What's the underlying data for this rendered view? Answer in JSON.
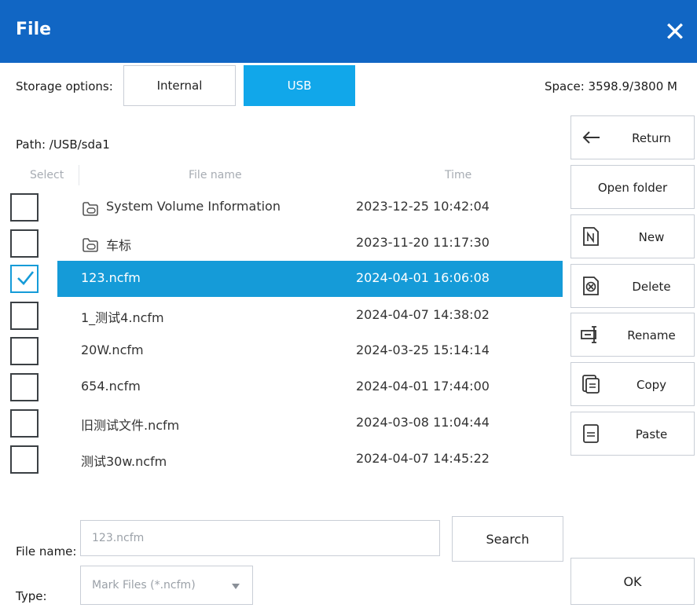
{
  "window": {
    "title": "File",
    "close_glyph": "✕"
  },
  "storage": {
    "label": "Storage options:",
    "options": [
      "Internal",
      "USB"
    ],
    "selected": "USB",
    "space": "Space:  3598.9/3800  M"
  },
  "path": "Path:  /USB/sda1",
  "table": {
    "headers": {
      "select": "Select",
      "name": "File name",
      "time": "Time"
    },
    "rows": [
      {
        "name": "System Volume Information",
        "time": "2023-12-25  10:42:04",
        "folder": true,
        "checked": false,
        "selected": false
      },
      {
        "name": "车标",
        "time": "2023-11-20  11:17:30",
        "folder": true,
        "checked": false,
        "selected": false
      },
      {
        "name": "123.ncfm",
        "time": "2024-04-01  16:06:08",
        "folder": false,
        "checked": true,
        "selected": true
      },
      {
        "name": "1_测试4.ncfm",
        "time": "2024-04-07  14:38:02",
        "folder": false,
        "checked": false,
        "selected": false
      },
      {
        "name": "20W.ncfm",
        "time": "2024-03-25  15:14:14",
        "folder": false,
        "checked": false,
        "selected": false
      },
      {
        "name": "654.ncfm",
        "time": "2024-04-01  17:44:00",
        "folder": false,
        "checked": false,
        "selected": false
      },
      {
        "name": "旧测试文件.ncfm",
        "time": "2024-03-08  11:04:44",
        "folder": false,
        "checked": false,
        "selected": false
      },
      {
        "name": "测试30w.ncfm",
        "time": "2024-04-07  14:45:22",
        "folder": false,
        "checked": false,
        "selected": false
      }
    ]
  },
  "side_buttons": [
    {
      "label": "Return",
      "icon": "arrow-left-icon"
    },
    {
      "label": "Open folder",
      "icon": ""
    },
    {
      "label": "New",
      "icon": "new-file-icon"
    },
    {
      "label": "Delete",
      "icon": "delete-file-icon"
    },
    {
      "label": "Rename",
      "icon": "rename-icon"
    },
    {
      "label": "Copy",
      "icon": "copy-icon"
    },
    {
      "label": "Paste",
      "icon": "paste-icon"
    }
  ],
  "bottom": {
    "filename_label": "File name:",
    "filename_value": "123.ncfm",
    "search_label": "Search",
    "type_label": "Type:",
    "type_value": "Mark Files (*.ncfm)",
    "ok_label": "OK"
  },
  "colors": {
    "titlebar": "#1166c4",
    "accent": "#11a7ea",
    "selection": "#159bd8"
  }
}
